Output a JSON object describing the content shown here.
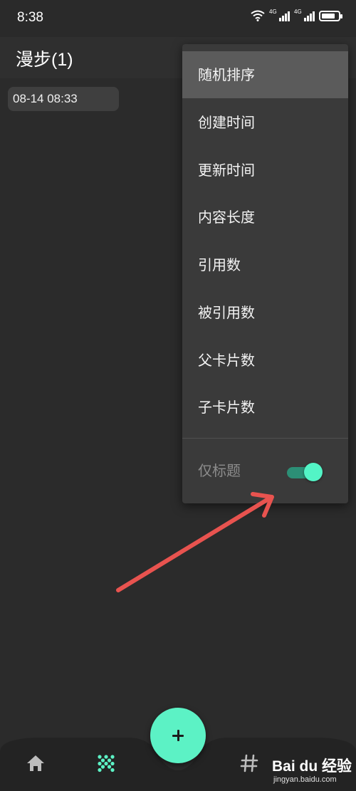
{
  "status_bar": {
    "time": "8:38",
    "signal_1_label": "4G",
    "signal_2_label": "4G"
  },
  "header": {
    "title": "漫步(1)"
  },
  "cards": [
    {
      "timestamp": "08-14 08:33"
    }
  ],
  "sort_menu": {
    "items": [
      {
        "label": "随机排序",
        "selected": true
      },
      {
        "label": "创建时间",
        "selected": false
      },
      {
        "label": "更新时间",
        "selected": false
      },
      {
        "label": "内容长度",
        "selected": false
      },
      {
        "label": "引用数",
        "selected": false
      },
      {
        "label": "被引用数",
        "selected": false
      },
      {
        "label": "父卡片数",
        "selected": false
      },
      {
        "label": "子卡片数",
        "selected": false
      }
    ],
    "title_only_label": "仅标题",
    "title_only_enabled": true
  },
  "bottom_nav": {
    "items": [
      {
        "icon": "home-icon",
        "active": false
      },
      {
        "icon": "shuffle-dots-icon",
        "active": true
      },
      {
        "icon": "hashtag-icon",
        "active": false
      }
    ],
    "fab_icon": "plus-icon"
  },
  "watermark": {
    "brand": "Bai du 经验",
    "url": "jingyan.baidu.com"
  },
  "colors": {
    "background": "#2b2b2b",
    "accent": "#5cf2c5",
    "menu_background": "#3a3a3a",
    "menu_selected": "#5b5b5b",
    "annotation_arrow": "#e8534f"
  }
}
